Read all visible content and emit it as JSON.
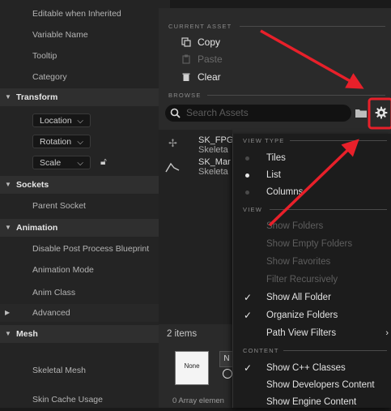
{
  "details": {
    "rows": {
      "editable": "Editable when Inherited",
      "variable_name": "Variable Name",
      "tooltip": "Tooltip",
      "category": "Category",
      "transform": "Transform",
      "sockets": "Sockets",
      "parent_socket": "Parent Socket",
      "animation": "Animation",
      "disable_pp": "Disable Post Process Blueprint",
      "anim_mode": "Animation Mode",
      "anim_class": "Anim Class",
      "advanced": "Advanced",
      "mesh": "Mesh",
      "skeletal_mesh": "Skeletal Mesh",
      "skin_cache": "Skin Cache Usage"
    },
    "transform_dropdowns": {
      "location": "Location",
      "rotation": "Rotation",
      "scale": "Scale"
    }
  },
  "picker": {
    "current_asset_header": "CURRENT ASSET",
    "copy": "Copy",
    "paste": "Paste",
    "clear": "Clear",
    "browse_header": "BROWSE",
    "search_placeholder": "Search Assets",
    "assets": [
      {
        "name": "SK_FPG",
        "type": "Skeleta"
      },
      {
        "name": "SK_Mar",
        "type": "Skeleta"
      }
    ],
    "item_count": "2 items",
    "thumb_none": "None",
    "thumb_letter": "N",
    "array_elements": "0 Array elemen"
  },
  "view_menu": {
    "view_type_header": "VIEW TYPE",
    "view_type": [
      "Tiles",
      "List",
      "Columns"
    ],
    "view_header": "VIEW",
    "view_items": [
      {
        "label": "Show Folders",
        "enabled": false,
        "checked": false
      },
      {
        "label": "Show Empty Folders",
        "enabled": false,
        "checked": false
      },
      {
        "label": "Show Favorites",
        "enabled": false,
        "checked": false
      },
      {
        "label": "Filter Recursively",
        "enabled": false,
        "checked": false
      },
      {
        "label": "Show All Folder",
        "enabled": true,
        "checked": true
      },
      {
        "label": "Organize Folders",
        "enabled": true,
        "checked": true
      },
      {
        "label": "Path View Filters",
        "enabled": true,
        "checked": false
      }
    ],
    "content_header": "CONTENT",
    "content_items": [
      {
        "label": "Show C++ Classes",
        "checked": true
      },
      {
        "label": "Show Developers Content",
        "checked": false
      },
      {
        "label": "Show Engine Content",
        "checked": false
      }
    ]
  },
  "colors": {
    "annotation_red": "#e8202a",
    "panel_bg": "#242424",
    "menu_bg": "#1c1c1c"
  }
}
